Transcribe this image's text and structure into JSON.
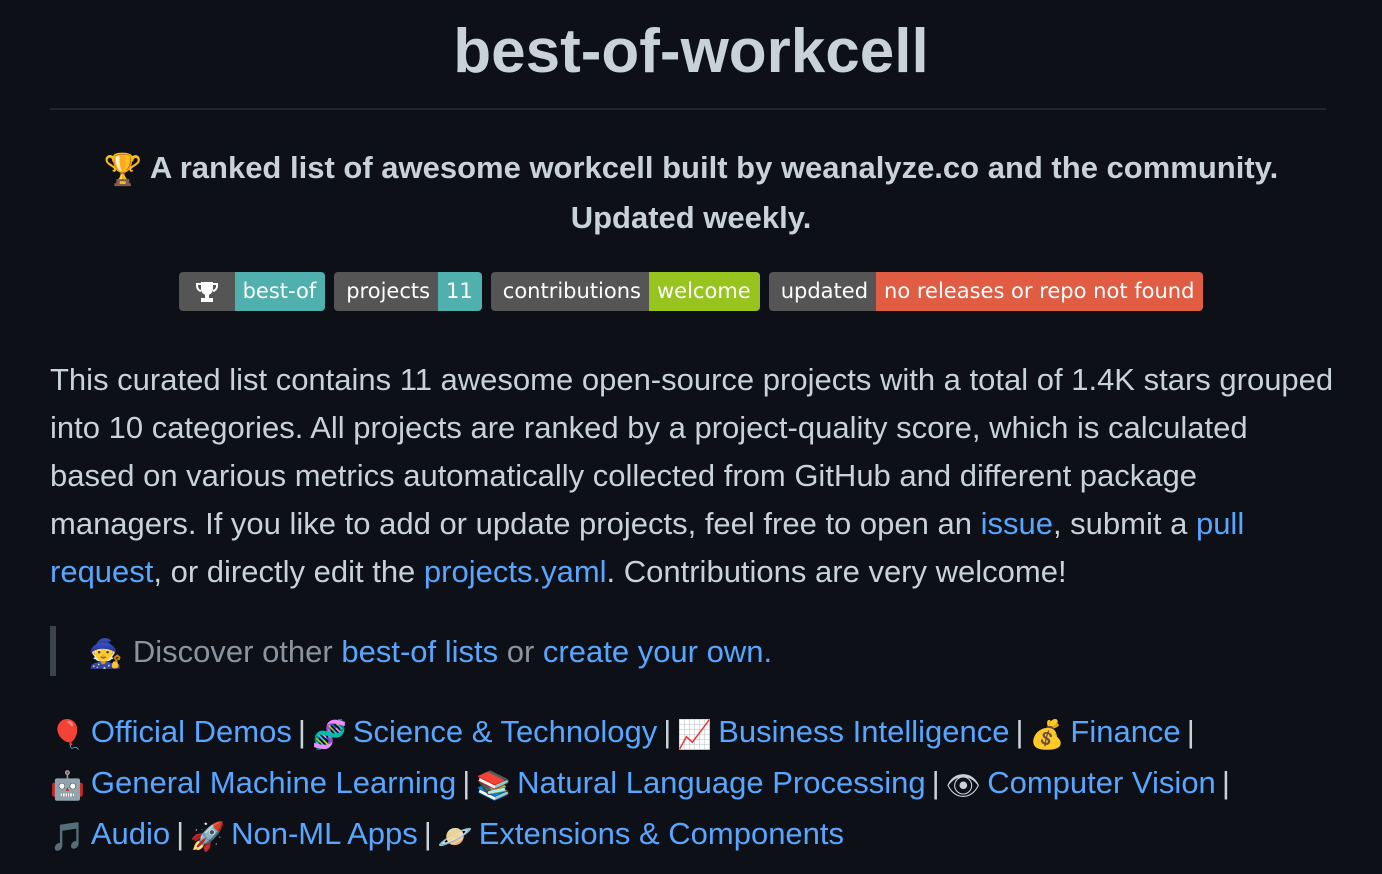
{
  "title": "best-of-workcell",
  "tagline": {
    "emoji": "🏆",
    "text": "A ranked list of awesome workcell built by weanalyze.co and the community. Updated weekly."
  },
  "badges": [
    {
      "left": "",
      "right": "best-of",
      "left_icon": "trophy-icon",
      "right_color": "#4fb0ae"
    },
    {
      "left": "projects",
      "right": "11",
      "right_color": "#4fb0ae"
    },
    {
      "left": "contributions",
      "right": "welcome",
      "right_color": "#97c41f"
    },
    {
      "left": "updated",
      "right": "no releases or repo not found",
      "right_color": "#e05d44"
    }
  ],
  "intro": {
    "text1": "This curated list contains 11 awesome open-source projects with a total of 1.4K stars grouped into 10 categories. All projects are ranked by a project-quality score, which is calculated based on various metrics automatically collected from GitHub and different package managers. If you like to add or update projects, feel free to open an ",
    "link_issue": "issue",
    "text2": ", submit a ",
    "link_pr": "pull request",
    "text3": ", or directly edit the ",
    "link_yaml": "projects.yaml",
    "text4": ". Contributions are very welcome!"
  },
  "discover": {
    "emoji": "🧙",
    "prefix": "Discover other ",
    "link_lists": "best-of lists",
    "middle": " or ",
    "link_create": "create your own",
    "suffix": "."
  },
  "categories": [
    {
      "emoji": "🎈",
      "label": "Official Demos"
    },
    {
      "emoji": "🧬",
      "label": "Science & Technology"
    },
    {
      "emoji": "📈",
      "label": "Business Intelligence"
    },
    {
      "emoji": "💰",
      "label": "Finance"
    },
    {
      "emoji": "🤖",
      "label": "General Machine Learning"
    },
    {
      "emoji": "📚",
      "label": "Natural Language Processing"
    },
    {
      "emoji": "👁",
      "label": "Computer Vision"
    },
    {
      "emoji": "🎵",
      "label": "Audio"
    },
    {
      "emoji": "🚀",
      "label": "Non-ML Apps"
    },
    {
      "emoji": "🪐",
      "label": "Extensions & Components"
    }
  ],
  "separator": "|"
}
